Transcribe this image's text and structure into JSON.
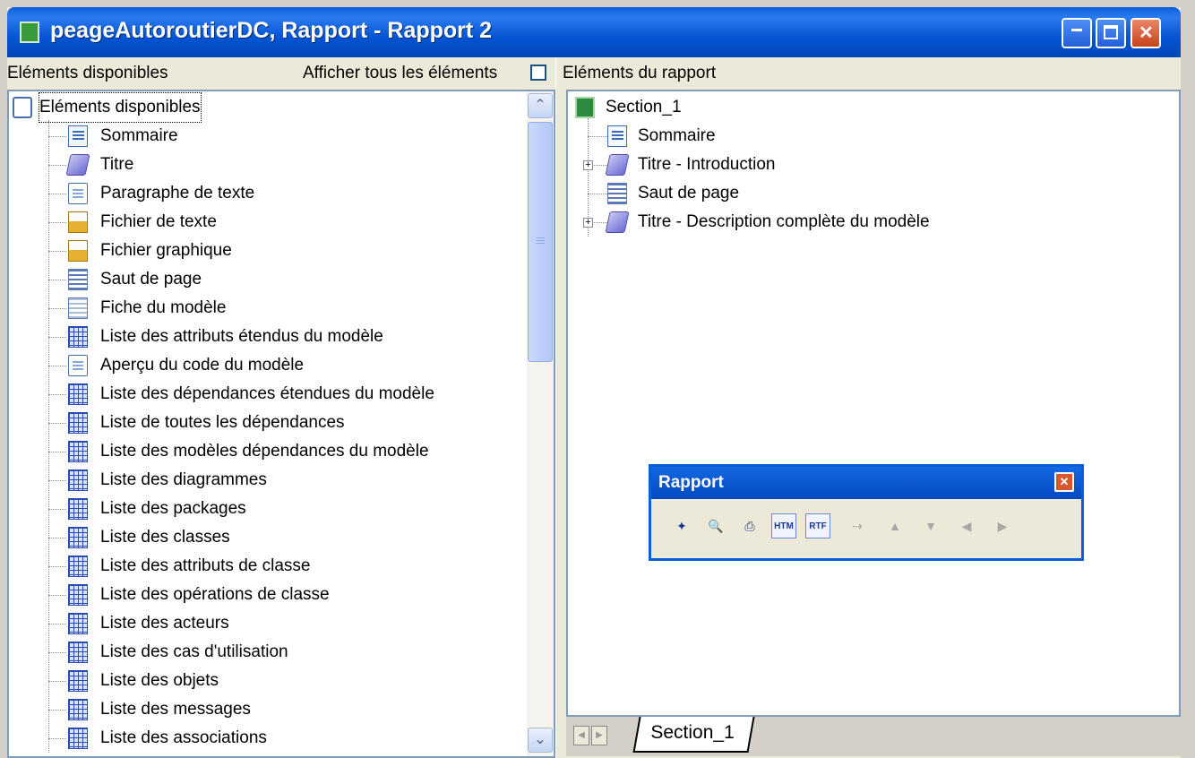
{
  "window": {
    "title": "peageAutoroutierDC, Rapport - Rapport 2",
    "min_glyph": "_",
    "max_glyph": "□",
    "close_glyph": "✕"
  },
  "left_panel": {
    "header": "Eléments disponibles",
    "show_all_label": "Afficher tous les éléments",
    "show_all_checked": false,
    "root": {
      "label": "Eléments disponibles",
      "icon": "book-icon"
    },
    "items": [
      {
        "label": "Sommaire",
        "icon": "summary-icon"
      },
      {
        "label": "Titre",
        "icon": "title-icon"
      },
      {
        "label": "Paragraphe de texte",
        "icon": "document-icon"
      },
      {
        "label": "Fichier de texte",
        "icon": "text-file-icon"
      },
      {
        "label": "Fichier graphique",
        "icon": "graphic-file-icon"
      },
      {
        "label": "Saut de page",
        "icon": "page-break-icon"
      },
      {
        "label": "Fiche du modèle",
        "icon": "model-card-icon"
      },
      {
        "label": "Liste des attributs étendus du modèle",
        "icon": "list-grid-icon"
      },
      {
        "label": "Aperçu du code du modèle",
        "icon": "document-icon"
      },
      {
        "label": "Liste des dépendances étendues du modèle",
        "icon": "list-grid-icon"
      },
      {
        "label": "Liste de toutes les dépendances",
        "icon": "list-grid-icon"
      },
      {
        "label": "Liste des modèles dépendances du modèle",
        "icon": "list-grid-icon"
      },
      {
        "label": "Liste des diagrammes",
        "icon": "list-grid-icon"
      },
      {
        "label": "Liste des packages",
        "icon": "list-grid-icon"
      },
      {
        "label": "Liste des classes",
        "icon": "list-grid-icon"
      },
      {
        "label": "Liste des attributs de classe",
        "icon": "list-grid-icon"
      },
      {
        "label": "Liste des opérations de classe",
        "icon": "list-grid-icon"
      },
      {
        "label": "Liste des acteurs",
        "icon": "list-grid-icon"
      },
      {
        "label": "Liste des cas d'utilisation",
        "icon": "list-grid-icon"
      },
      {
        "label": "Liste des objets",
        "icon": "list-grid-icon"
      },
      {
        "label": "Liste des messages",
        "icon": "list-grid-icon"
      },
      {
        "label": "Liste des associations",
        "icon": "list-grid-icon"
      }
    ]
  },
  "right_panel": {
    "header": "Eléments du rapport",
    "root": {
      "label": "Section_1",
      "icon": "section-icon"
    },
    "items": [
      {
        "label": "Sommaire",
        "icon": "summary-icon",
        "expandable": false
      },
      {
        "label": "Titre - Introduction",
        "icon": "title-icon",
        "expandable": true
      },
      {
        "label": "Saut de page",
        "icon": "page-break-icon",
        "expandable": false
      },
      {
        "label": "Titre - Description complète du modèle",
        "icon": "title-icon",
        "expandable": true
      }
    ],
    "expander_glyph": "+",
    "tab_label": "Section_1"
  },
  "rapport_toolbar": {
    "title": "Rapport",
    "close_glyph": "✕",
    "tools": [
      {
        "name": "wizard-icon",
        "glyph": "✦",
        "enabled": true
      },
      {
        "name": "print-preview-icon",
        "glyph": "🔍",
        "enabled": true
      },
      {
        "name": "print-icon",
        "glyph": "⎙",
        "enabled": true
      },
      {
        "name": "generate-html-icon",
        "glyph": "HTM",
        "enabled": true
      },
      {
        "name": "generate-rtf-icon",
        "glyph": "RTF",
        "enabled": true
      },
      {
        "name": "tree-icon",
        "glyph": "⇢",
        "enabled": false
      },
      {
        "name": "move-up-icon",
        "glyph": "▲",
        "enabled": false
      },
      {
        "name": "move-down-icon",
        "glyph": "▼",
        "enabled": false
      },
      {
        "name": "move-left-icon",
        "glyph": "◀",
        "enabled": false
      },
      {
        "name": "move-right-icon",
        "glyph": "▶",
        "enabled": false
      }
    ]
  },
  "scrollbar": {
    "up_glyph": "⌃",
    "down_glyph": "⌄"
  },
  "tab_nav": {
    "prev_glyph": "◀",
    "next_glyph": "▶"
  }
}
